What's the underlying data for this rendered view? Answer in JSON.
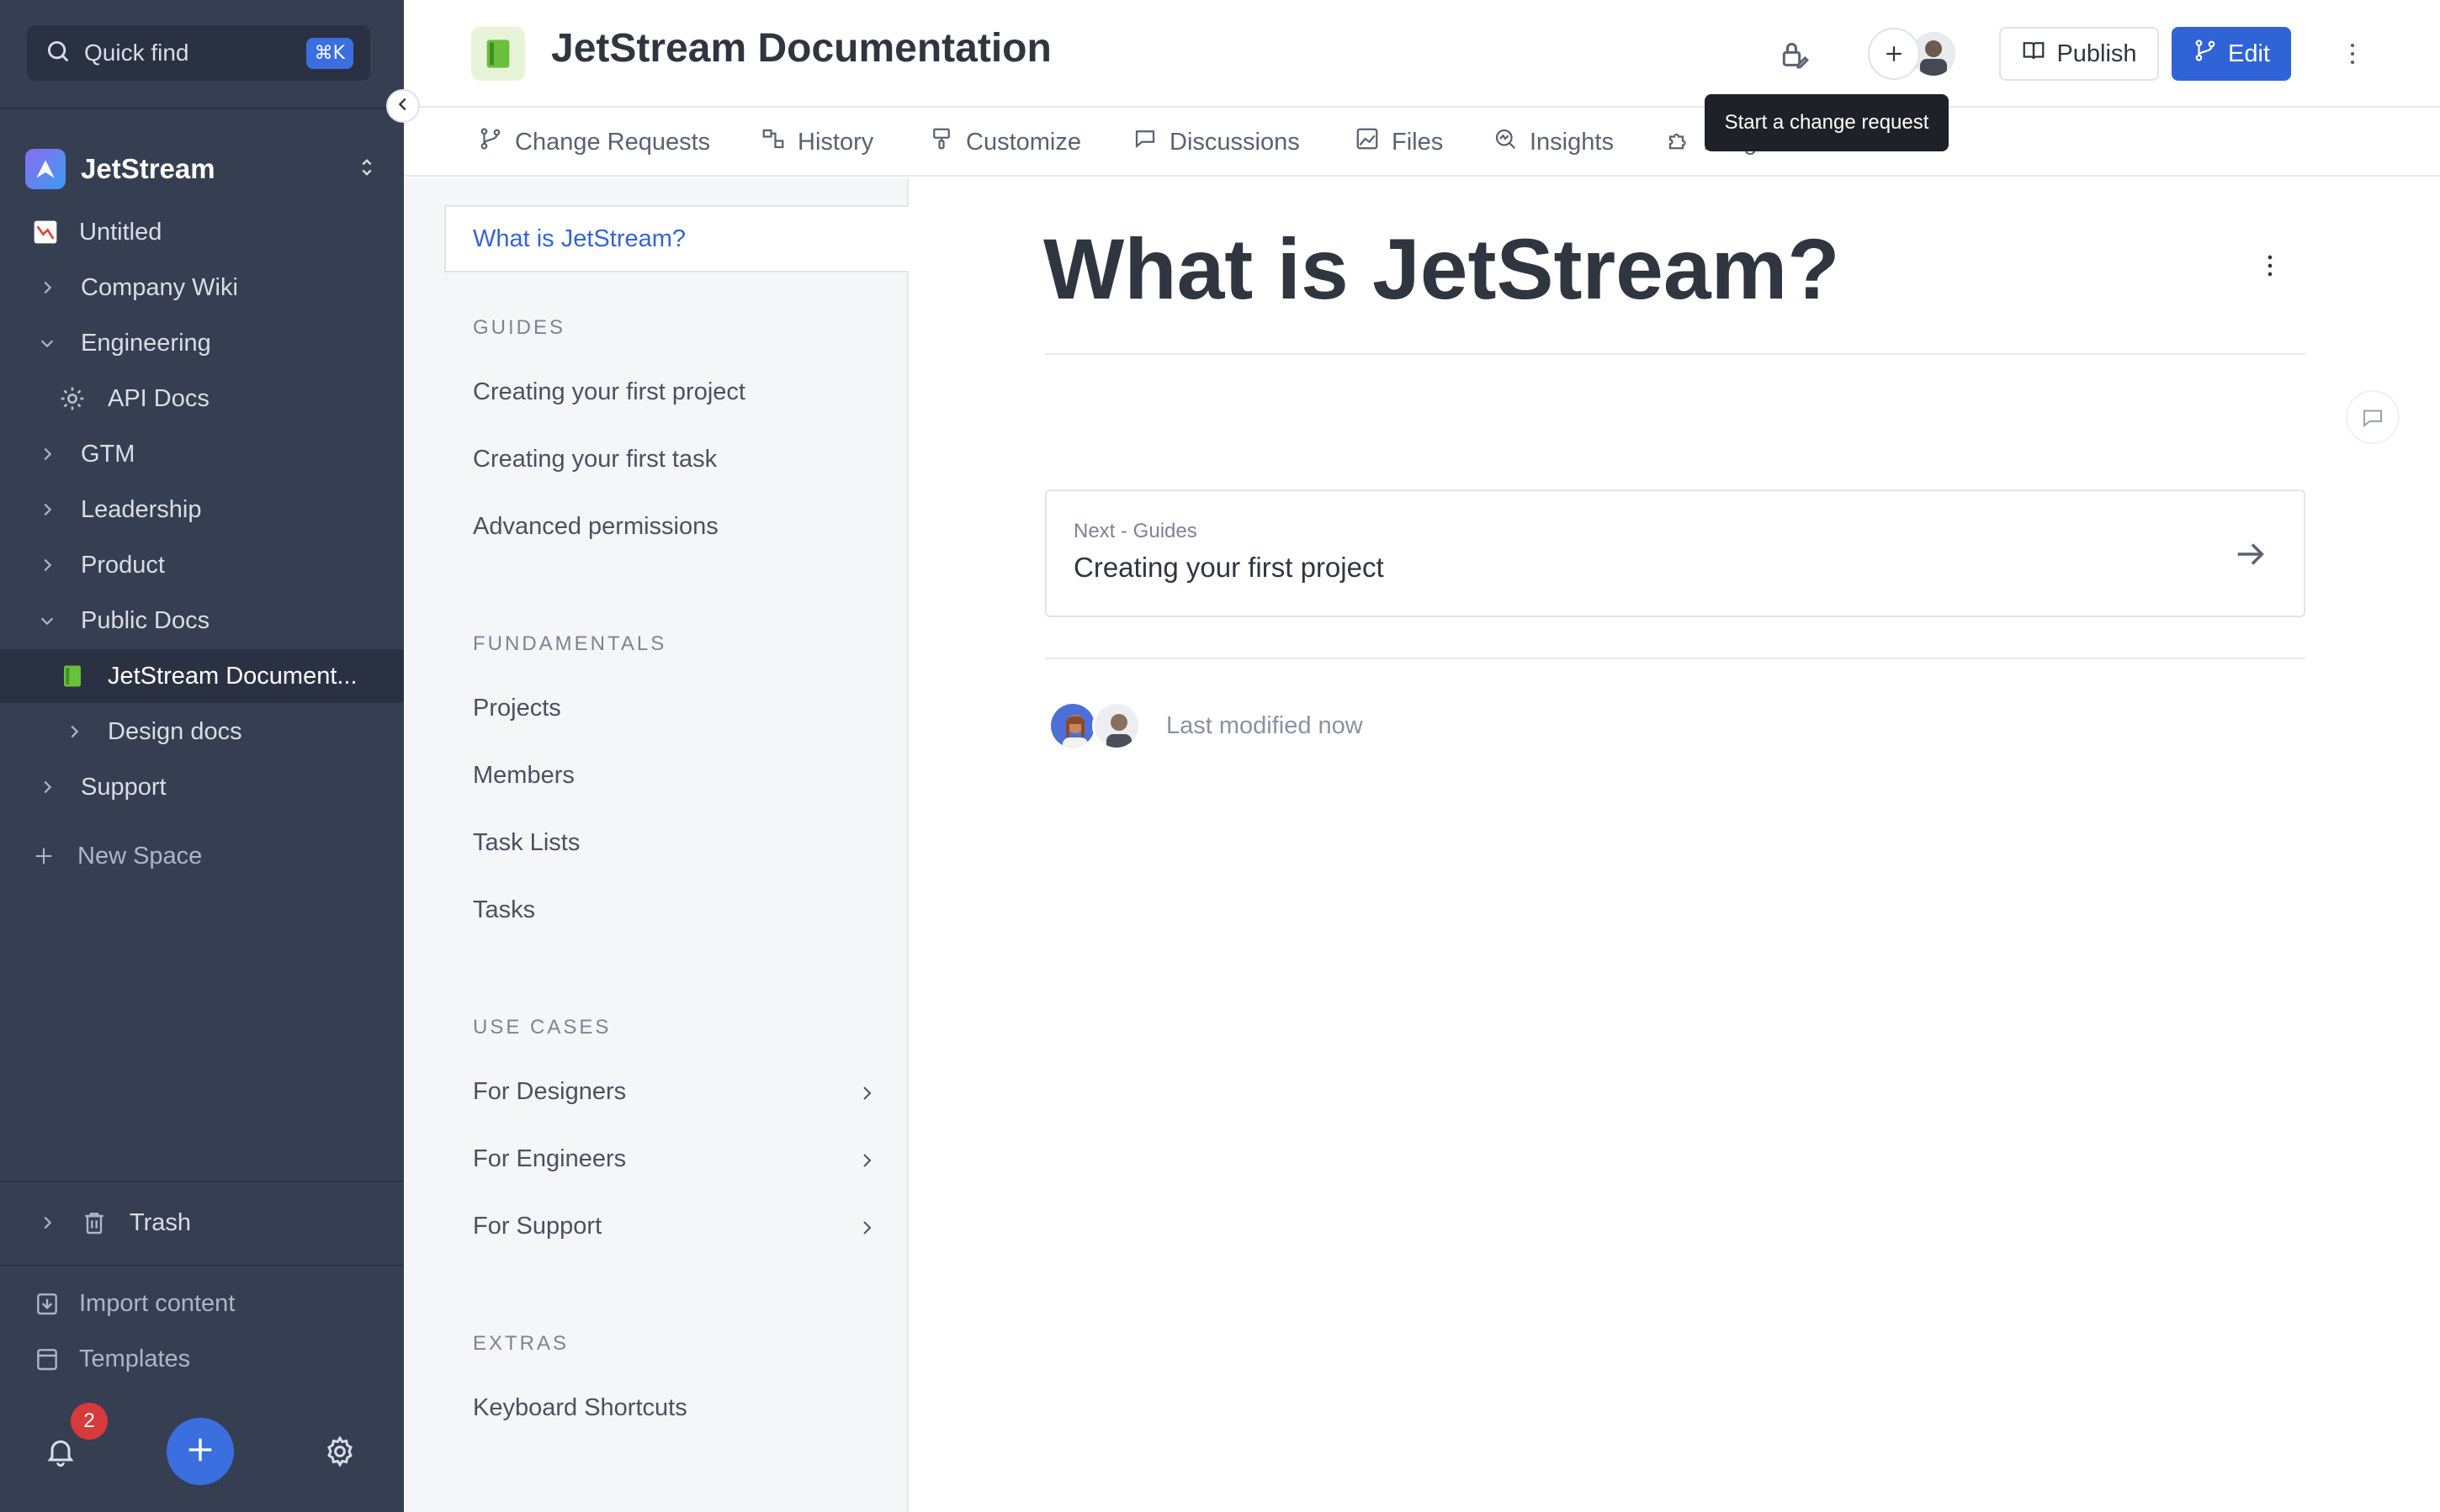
{
  "sidebar": {
    "search": {
      "label": "Quick find",
      "shortcut": "⌘K"
    },
    "org": {
      "name": "JetStream"
    },
    "items": [
      {
        "label": "Untitled"
      },
      {
        "label": "Company Wiki"
      },
      {
        "label": "Engineering"
      },
      {
        "label": "API Docs"
      },
      {
        "label": "GTM"
      },
      {
        "label": "Leadership"
      },
      {
        "label": "Product"
      },
      {
        "label": "Public Docs"
      },
      {
        "label": "JetStream Document..."
      },
      {
        "label": "Design docs"
      },
      {
        "label": "Support"
      }
    ],
    "new_space": "New Space",
    "trash": "Trash",
    "import_content": "Import content",
    "templates": "Templates",
    "notification_count": "2"
  },
  "header": {
    "title": "JetStream Documentation",
    "publish_label": "Publish",
    "edit_label": "Edit",
    "tooltip": "Start a change request"
  },
  "tabs": [
    {
      "label": "Change Requests"
    },
    {
      "label": "History"
    },
    {
      "label": "Customize"
    },
    {
      "label": "Discussions"
    },
    {
      "label": "Files"
    },
    {
      "label": "Insights"
    },
    {
      "label": "Integrations"
    }
  ],
  "page_nav": {
    "active": "What is JetStream?",
    "sections": [
      {
        "heading": "GUIDES",
        "items": [
          "Creating your first project",
          "Creating your first task",
          "Advanced permissions"
        ]
      },
      {
        "heading": "FUNDAMENTALS",
        "items": [
          "Projects",
          "Members",
          "Task Lists",
          "Tasks"
        ]
      },
      {
        "heading": "USE CASES",
        "items": [
          "For Designers",
          "For Engineers",
          "For Support"
        ]
      },
      {
        "heading": "EXTRAS",
        "items": [
          "Keyboard Shortcuts"
        ]
      }
    ]
  },
  "content": {
    "title": "What is JetStream?",
    "next": {
      "subtitle": "Next - Guides",
      "title": "Creating your first project"
    },
    "last_modified": "Last modified now"
  },
  "colors": {
    "sidebar_bg": "#363e52",
    "accent": "#2f63d6",
    "link": "#3464d6",
    "badge": "#d63a3a"
  }
}
